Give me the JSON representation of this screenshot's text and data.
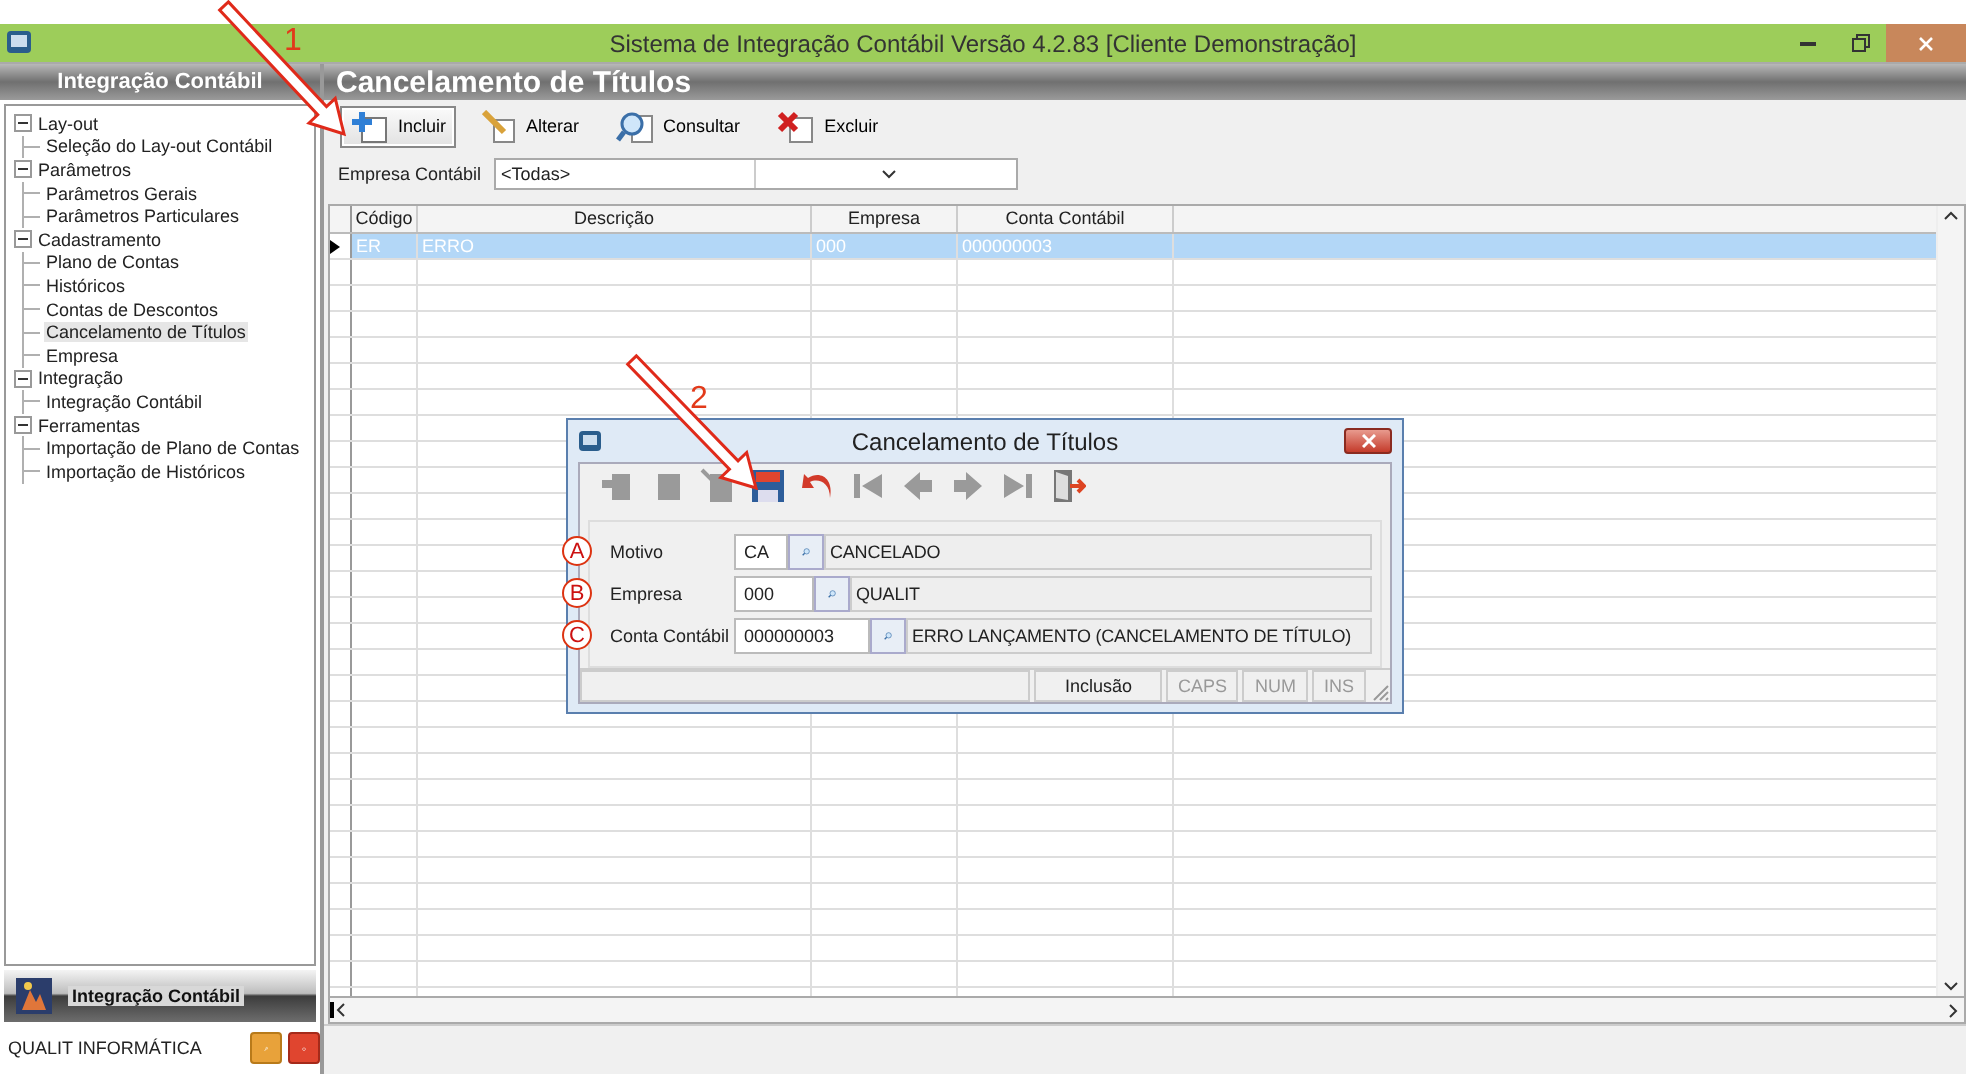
{
  "window": {
    "title": "Sistema de Integração Contábil Versão 4.2.83 [Cliente Demonstração]"
  },
  "sidebar": {
    "header": "Integração Contábil",
    "tree": [
      {
        "label": "Lay-out",
        "expanded": true,
        "selected": false,
        "children": [
          {
            "label": "Seleção do Lay-out Contábil",
            "selected": false
          }
        ]
      },
      {
        "label": "Parâmetros",
        "expanded": true,
        "selected": false,
        "children": [
          {
            "label": "Parâmetros Gerais",
            "selected": false
          },
          {
            "label": "Parâmetros Particulares",
            "selected": false
          }
        ]
      },
      {
        "label": "Cadastramento",
        "expanded": true,
        "selected": false,
        "children": [
          {
            "label": "Plano de Contas",
            "selected": false
          },
          {
            "label": "Históricos",
            "selected": false
          },
          {
            "label": "Contas de Descontos",
            "selected": false
          },
          {
            "label": "Cancelamento de Títulos",
            "selected": true
          },
          {
            "label": "Empresa",
            "selected": false
          }
        ]
      },
      {
        "label": "Integração",
        "expanded": true,
        "selected": false,
        "children": [
          {
            "label": "Integração Contábil",
            "selected": false
          }
        ]
      },
      {
        "label": "Ferramentas",
        "expanded": true,
        "selected": false,
        "children": [
          {
            "label": "Importação de Plano de Contas",
            "selected": false
          },
          {
            "label": "Importação de Históricos",
            "selected": false
          }
        ]
      }
    ],
    "module_button": "Integração Contábil",
    "footer": "QUALIT INFORMÁTICA"
  },
  "content": {
    "header": "Cancelamento de Títulos",
    "toolbar": [
      {
        "label": "Incluir",
        "kind": "add",
        "focused": true
      },
      {
        "label": "Alterar",
        "kind": "edit",
        "focused": false
      },
      {
        "label": "Consultar",
        "kind": "search",
        "focused": false
      },
      {
        "label": "Excluir",
        "kind": "delete",
        "focused": false
      }
    ],
    "filter": {
      "label": "Empresa Contábil",
      "value": "<Todas>"
    },
    "grid": {
      "columns": [
        "Código",
        "Descrição",
        "Empresa",
        "Conta Contábil"
      ],
      "rows": [
        {
          "cells": [
            "ER",
            "ERRO",
            "000",
            "000000003"
          ],
          "selected": true
        }
      ]
    }
  },
  "dialog": {
    "title": "Cancelamento de Títulos",
    "toolbar": [
      {
        "kind": "new",
        "disabled": true
      },
      {
        "kind": "edit",
        "disabled": true
      },
      {
        "kind": "delete",
        "disabled": true
      },
      {
        "kind": "save",
        "disabled": false
      },
      {
        "kind": "undo",
        "disabled": false
      },
      {
        "kind": "first",
        "disabled": true
      },
      {
        "kind": "prev",
        "disabled": true
      },
      {
        "kind": "next",
        "disabled": true
      },
      {
        "kind": "last",
        "disabled": true
      },
      {
        "kind": "exit",
        "disabled": false
      }
    ],
    "fields": [
      {
        "marker": "A",
        "label": "Motivo",
        "code": "CA",
        "description": "CANCELADO"
      },
      {
        "marker": "B",
        "label": "Empresa",
        "code": "000",
        "description": "QUALIT"
      },
      {
        "marker": "C",
        "label": "Conta Contábil",
        "code": "000000003",
        "description": "ERRO LANÇAMENTO (CANCELAMENTO DE TÍTULO)"
      }
    ],
    "status": [
      {
        "text": "Inclusão",
        "disabled": false
      },
      {
        "text": "CAPS",
        "disabled": true
      },
      {
        "text": "NUM",
        "disabled": true
      },
      {
        "text": "INS",
        "disabled": true
      }
    ]
  },
  "annotations": [
    {
      "kind": "arrow",
      "label": "1"
    },
    {
      "kind": "arrow",
      "label": "2"
    }
  ]
}
